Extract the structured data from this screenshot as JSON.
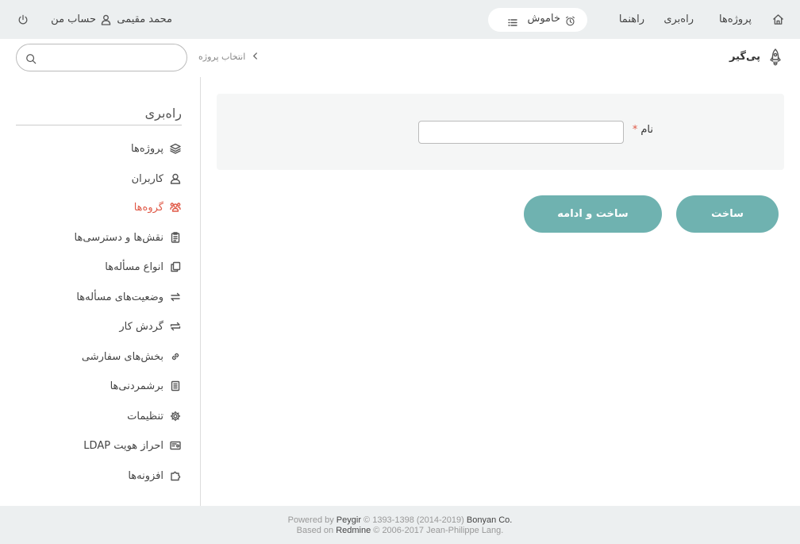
{
  "topbar": {
    "nav": {
      "projects": "پروژه‌ها",
      "admin": "راه‌بری",
      "help": "راهنما"
    },
    "timer_status": "خاموش",
    "user_name": "محمد مقیمی",
    "my_account": "حساب من"
  },
  "header": {
    "brand": "پی‌گیر",
    "breadcrumb": "انتخاب پروژه",
    "search_placeholder": ""
  },
  "sidebar": {
    "title": "راه‌بری",
    "items": [
      {
        "label": "پروژه‌ها",
        "icon": "layers-icon"
      },
      {
        "label": "کاربران",
        "icon": "user-icon"
      },
      {
        "label": "گروه‌ها",
        "icon": "group-icon",
        "active": true
      },
      {
        "label": "نقش‌ها و دسترسی‌ها",
        "icon": "clipboard-icon"
      },
      {
        "label": "انواع مسأله‌ها",
        "icon": "copy-icon"
      },
      {
        "label": "وضعیت‌های مسأله‌ها",
        "icon": "swap-icon"
      },
      {
        "label": "گردش کار",
        "icon": "repeat-icon"
      },
      {
        "label": "بخش‌های سفارشی",
        "icon": "link-icon"
      },
      {
        "label": "برشمردنی‌ها",
        "icon": "list-doc-icon"
      },
      {
        "label": "تنظیمات",
        "icon": "gear-icon"
      },
      {
        "label": "احراز هویت LDAP",
        "icon": "id-card-icon"
      },
      {
        "label": "افزونه‌ها",
        "icon": "puzzle-icon"
      }
    ]
  },
  "form": {
    "name_label": "نام",
    "required_mark": "*",
    "name_value": "",
    "create_button": "ساخت",
    "create_continue_button": "ساخت و ادامه"
  },
  "footer": {
    "powered_by": "Powered by",
    "peygir": "Peygir",
    "copyright1": "© 1393-1398 (2014-2019)",
    "bonyan": "Bonyan Co.",
    "based_on": "Based on",
    "redmine": "Redmine",
    "copyright2": "© 2006-2017 Jean-Philippe Lang."
  },
  "colors": {
    "accent": "#6fb2b0",
    "active": "#e05a48",
    "topbar_bg": "#eceff0"
  }
}
